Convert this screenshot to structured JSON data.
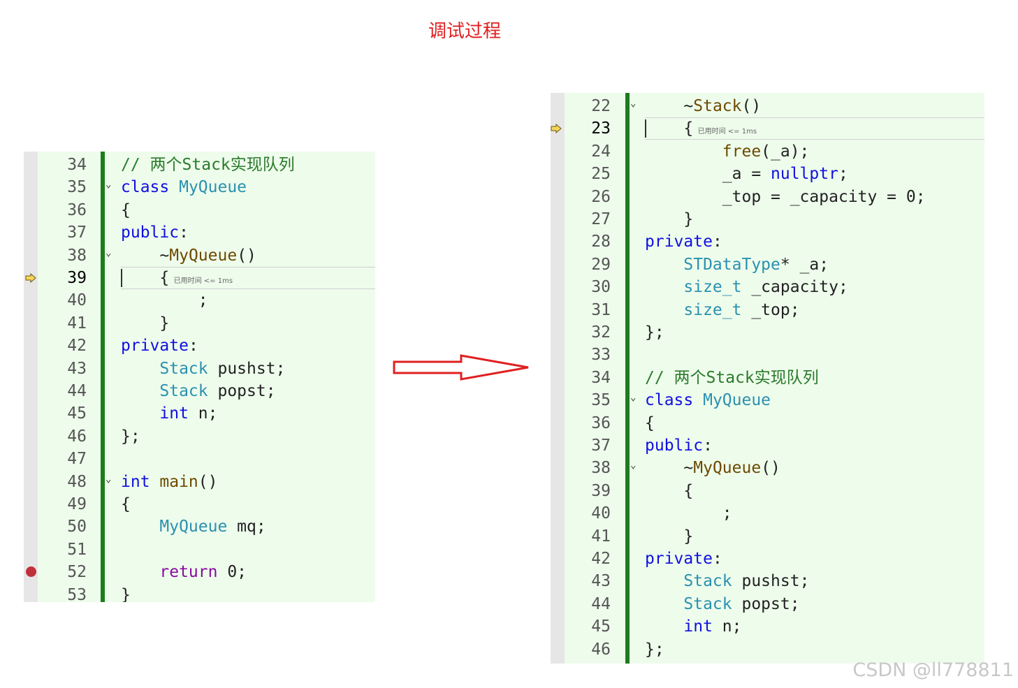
{
  "title": "调试过程",
  "watermark": "CSDN @ll778811",
  "perf_tip": "已用时间 <= 1ms",
  "left_panel": {
    "current_line": "39",
    "breakpoint_line": "52",
    "lines": [
      {
        "n": "34",
        "tokens": [
          {
            "c": "cm",
            "t": "// 两个Stack实现队列"
          }
        ]
      },
      {
        "n": "35",
        "fold": true,
        "tokens": [
          {
            "c": "kw",
            "t": "class "
          },
          {
            "c": "ty",
            "t": "MyQueue"
          }
        ]
      },
      {
        "n": "36",
        "tokens": [
          {
            "c": "",
            "t": "{"
          }
        ]
      },
      {
        "n": "37",
        "tokens": [
          {
            "c": "kw",
            "t": "public"
          },
          {
            "c": "",
            "t": ":"
          }
        ]
      },
      {
        "n": "38",
        "fold": true,
        "tokens": [
          {
            "c": "",
            "t": "    ~"
          },
          {
            "c": "fn",
            "t": "MyQueue"
          },
          {
            "c": "",
            "t": "()"
          }
        ]
      },
      {
        "n": "39",
        "tokens": [
          {
            "c": "",
            "t": "    {"
          }
        ]
      },
      {
        "n": "40",
        "tokens": [
          {
            "c": "",
            "t": "        ;"
          }
        ]
      },
      {
        "n": "41",
        "tokens": [
          {
            "c": "",
            "t": "    }"
          }
        ]
      },
      {
        "n": "42",
        "tokens": [
          {
            "c": "kw",
            "t": "private"
          },
          {
            "c": "",
            "t": ":"
          }
        ]
      },
      {
        "n": "43",
        "tokens": [
          {
            "c": "",
            "t": "    "
          },
          {
            "c": "ty",
            "t": "Stack"
          },
          {
            "c": "",
            "t": " pushst;"
          }
        ]
      },
      {
        "n": "44",
        "tokens": [
          {
            "c": "",
            "t": "    "
          },
          {
            "c": "ty",
            "t": "Stack"
          },
          {
            "c": "",
            "t": " popst;"
          }
        ]
      },
      {
        "n": "45",
        "tokens": [
          {
            "c": "",
            "t": "    "
          },
          {
            "c": "kw",
            "t": "int"
          },
          {
            "c": "",
            "t": " n;"
          }
        ]
      },
      {
        "n": "46",
        "tokens": [
          {
            "c": "",
            "t": "};"
          }
        ]
      },
      {
        "n": "47",
        "tokens": []
      },
      {
        "n": "48",
        "fold": true,
        "tokens": [
          {
            "c": "kw",
            "t": "int "
          },
          {
            "c": "fn",
            "t": "main"
          },
          {
            "c": "",
            "t": "()"
          }
        ]
      },
      {
        "n": "49",
        "tokens": [
          {
            "c": "",
            "t": "{"
          }
        ]
      },
      {
        "n": "50",
        "tokens": [
          {
            "c": "",
            "t": "    "
          },
          {
            "c": "ty",
            "t": "MyQueue"
          },
          {
            "c": "",
            "t": " mq;"
          }
        ]
      },
      {
        "n": "51",
        "tokens": []
      },
      {
        "n": "52",
        "tokens": [
          {
            "c": "",
            "t": "    "
          },
          {
            "c": "ret",
            "t": "return"
          },
          {
            "c": "",
            "t": " 0;"
          }
        ]
      },
      {
        "n": "53",
        "tokens": [
          {
            "c": "",
            "t": "}"
          }
        ]
      }
    ]
  },
  "right_panel": {
    "current_line": "23",
    "lines": [
      {
        "n": "22",
        "fold": true,
        "tokens": [
          {
            "c": "",
            "t": "    ~"
          },
          {
            "c": "fn",
            "t": "Stack"
          },
          {
            "c": "",
            "t": "()"
          }
        ]
      },
      {
        "n": "23",
        "tokens": [
          {
            "c": "",
            "t": "    {"
          }
        ]
      },
      {
        "n": "24",
        "tokens": [
          {
            "c": "",
            "t": "        "
          },
          {
            "c": "fn",
            "t": "free"
          },
          {
            "c": "",
            "t": "(_a);"
          }
        ]
      },
      {
        "n": "25",
        "tokens": [
          {
            "c": "",
            "t": "        _a = "
          },
          {
            "c": "kw",
            "t": "nullptr"
          },
          {
            "c": "",
            "t": ";"
          }
        ]
      },
      {
        "n": "26",
        "tokens": [
          {
            "c": "",
            "t": "        _top = _capacity = 0;"
          }
        ]
      },
      {
        "n": "27",
        "tokens": [
          {
            "c": "",
            "t": "    }"
          }
        ]
      },
      {
        "n": "28",
        "tokens": [
          {
            "c": "kw",
            "t": "private"
          },
          {
            "c": "",
            "t": ":"
          }
        ]
      },
      {
        "n": "29",
        "tokens": [
          {
            "c": "",
            "t": "    "
          },
          {
            "c": "ty",
            "t": "STDataType"
          },
          {
            "c": "",
            "t": "* _a;"
          }
        ]
      },
      {
        "n": "30",
        "tokens": [
          {
            "c": "",
            "t": "    "
          },
          {
            "c": "ty",
            "t": "size_t"
          },
          {
            "c": "",
            "t": " _capacity;"
          }
        ]
      },
      {
        "n": "31",
        "tokens": [
          {
            "c": "",
            "t": "    "
          },
          {
            "c": "ty",
            "t": "size_t"
          },
          {
            "c": "",
            "t": " _top;"
          }
        ]
      },
      {
        "n": "32",
        "tokens": [
          {
            "c": "",
            "t": "};"
          }
        ]
      },
      {
        "n": "33",
        "tokens": []
      },
      {
        "n": "34",
        "tokens": [
          {
            "c": "cm",
            "t": "// 两个Stack实现队列"
          }
        ]
      },
      {
        "n": "35",
        "fold": true,
        "tokens": [
          {
            "c": "kw",
            "t": "class "
          },
          {
            "c": "ty",
            "t": "MyQueue"
          }
        ]
      },
      {
        "n": "36",
        "tokens": [
          {
            "c": "",
            "t": "{"
          }
        ]
      },
      {
        "n": "37",
        "tokens": [
          {
            "c": "kw",
            "t": "public"
          },
          {
            "c": "",
            "t": ":"
          }
        ]
      },
      {
        "n": "38",
        "fold": true,
        "tokens": [
          {
            "c": "",
            "t": "    ~"
          },
          {
            "c": "fn",
            "t": "MyQueue"
          },
          {
            "c": "",
            "t": "()"
          }
        ]
      },
      {
        "n": "39",
        "tokens": [
          {
            "c": "",
            "t": "    {"
          }
        ]
      },
      {
        "n": "40",
        "tokens": [
          {
            "c": "",
            "t": "        ;"
          }
        ]
      },
      {
        "n": "41",
        "tokens": [
          {
            "c": "",
            "t": "    }"
          }
        ]
      },
      {
        "n": "42",
        "tokens": [
          {
            "c": "kw",
            "t": "private"
          },
          {
            "c": "",
            "t": ":"
          }
        ]
      },
      {
        "n": "43",
        "tokens": [
          {
            "c": "",
            "t": "    "
          },
          {
            "c": "ty",
            "t": "Stack"
          },
          {
            "c": "",
            "t": " pushst;"
          }
        ]
      },
      {
        "n": "44",
        "tokens": [
          {
            "c": "",
            "t": "    "
          },
          {
            "c": "ty",
            "t": "Stack"
          },
          {
            "c": "",
            "t": " popst;"
          }
        ]
      },
      {
        "n": "45",
        "tokens": [
          {
            "c": "",
            "t": "    "
          },
          {
            "c": "kw",
            "t": "int"
          },
          {
            "c": "",
            "t": " n;"
          }
        ]
      },
      {
        "n": "46",
        "tokens": [
          {
            "c": "",
            "t": "};"
          }
        ]
      }
    ]
  },
  "icons": {
    "execution_pointer": "current-statement-arrow-icon",
    "breakpoint": "breakpoint-icon",
    "transition": "right-arrow-icon",
    "fold": "chevron-down-icon"
  },
  "colors": {
    "title": "#e02020",
    "panel_bg": "#eefcec",
    "change_bar": "#1c7d1c",
    "keyword": "#1010e0",
    "type": "#2b91af",
    "comment": "#2a7a2a",
    "return_kw": "#8a0aa0",
    "breakpoint": "#c0303a",
    "arrow_outline": "#e02020"
  }
}
